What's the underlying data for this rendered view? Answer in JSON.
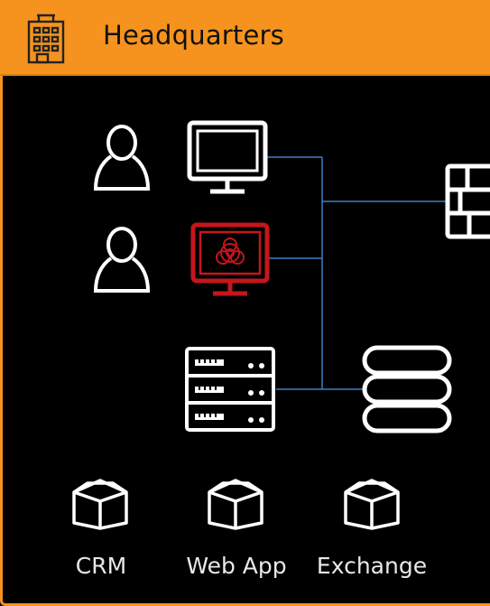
{
  "header": {
    "title": "Headquarters",
    "icon": "building-icon",
    "accent_color": "#f6931e"
  },
  "nodes": {
    "users": [
      {
        "icon": "user-icon"
      },
      {
        "icon": "user-icon"
      }
    ],
    "workstations": [
      {
        "icon": "monitor-icon",
        "status": "normal",
        "color": "#ffffff"
      },
      {
        "icon": "infected-monitor-icon",
        "status": "infected",
        "color": "#c4161c"
      }
    ],
    "server": {
      "icon": "server-rack-icon"
    },
    "database": {
      "icon": "database-icon"
    },
    "firewall": {
      "icon": "firewall-icon"
    }
  },
  "connector_color": "#3d7fc4",
  "apps": [
    {
      "label": "CRM",
      "icon": "package-icon"
    },
    {
      "label": "Web App",
      "icon": "package-icon"
    },
    {
      "label": "Exchange",
      "icon": "package-icon"
    }
  ]
}
